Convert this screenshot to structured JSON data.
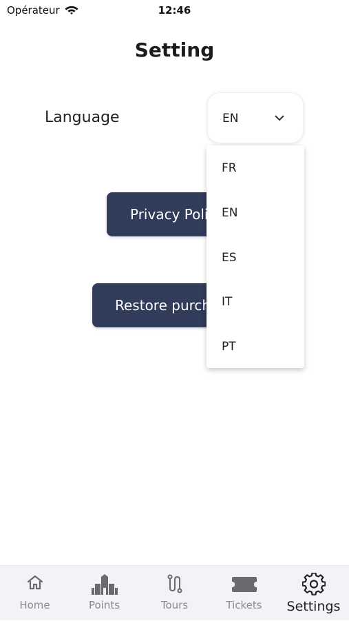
{
  "status_bar": {
    "carrier": "Opérateur",
    "time": "12:46"
  },
  "page": {
    "title": "Setting"
  },
  "language": {
    "label": "Language",
    "selected": "EN",
    "options": [
      "FR",
      "EN",
      "ES",
      "IT",
      "PT"
    ]
  },
  "buttons": {
    "privacy": "Privacy Policy",
    "restore": "Restore purchases"
  },
  "tab_bar": {
    "tabs": [
      {
        "label": "Home",
        "icon": "home-icon"
      },
      {
        "label": "Points",
        "icon": "monument-icon"
      },
      {
        "label": "Tours",
        "icon": "route-icon"
      },
      {
        "label": "Tickets",
        "icon": "ticket-icon"
      },
      {
        "label": "Settings",
        "icon": "gear-icon"
      }
    ],
    "active": "Settings"
  }
}
